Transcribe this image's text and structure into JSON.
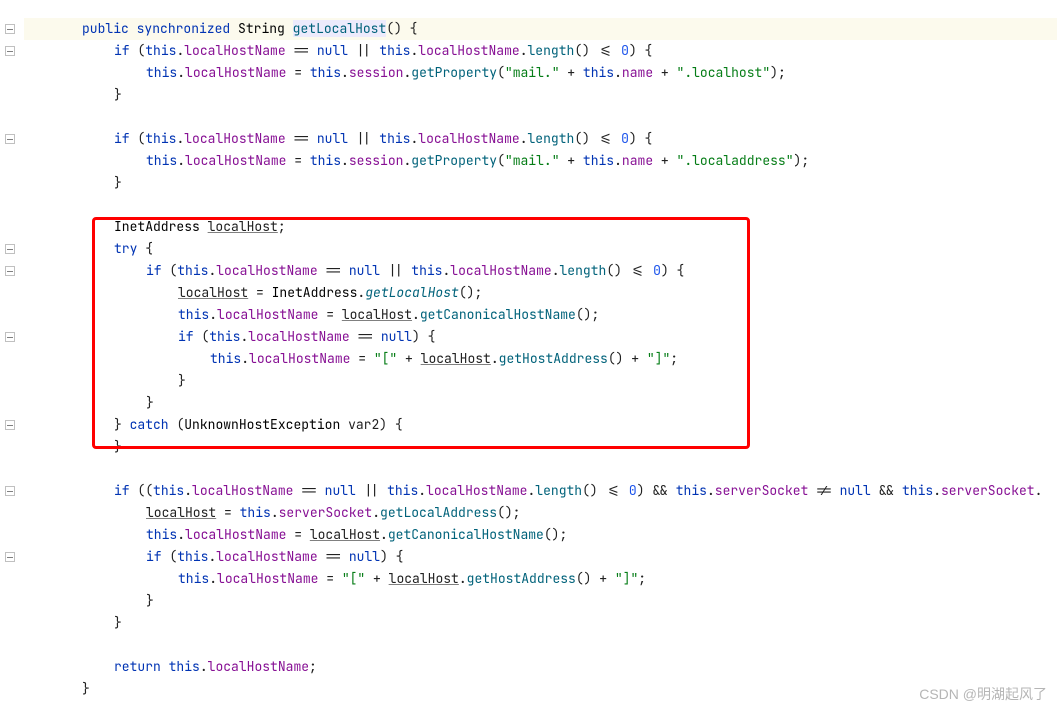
{
  "watermark": "CSDN @明湖起风了",
  "tokens": {
    "kw_public": "public",
    "kw_synchronized": "synchronized",
    "kw_if": "if",
    "kw_this": "this",
    "kw_null": "null",
    "kw_try": "try",
    "kw_catch": "catch",
    "kw_return": "return",
    "type_String": "String",
    "type_InetAddress": "InetAddress",
    "type_UnknownHostException": "UnknownHostException",
    "m_getLocalHost": "getLocalHost",
    "m_length": "length",
    "m_getProperty": "getProperty",
    "m_getCanonicalHostName": "getCanonicalHostName",
    "m_getHostAddress": "getHostAddress",
    "m_getLocalAddress": "getLocalAddress",
    "m_getLocalHost_static": "getLocalHost",
    "f_localHostName": "localHostName",
    "f_session": "session",
    "f_name": "name",
    "f_serverSocket": "serverSocket",
    "v_localHost": "localHost",
    "v_var2": "var2",
    "s_mail": "\"mail.\"",
    "s_localhost": "\".localhost\"",
    "s_localaddress": "\".localaddress\"",
    "s_lb": "\"[\"",
    "s_rb": "\"]\"",
    "n_0": "0",
    "eq": " == ",
    "or": " || ",
    "and": " && ",
    "ne": " != ",
    "le": " <= ",
    "assign": " = ",
    "plus": " + ",
    "dot": ".",
    "lparen": "(",
    "rparen": ")",
    "lbrace": "{",
    "rbrace": "}",
    "semi": ";",
    "comma": ", "
  }
}
